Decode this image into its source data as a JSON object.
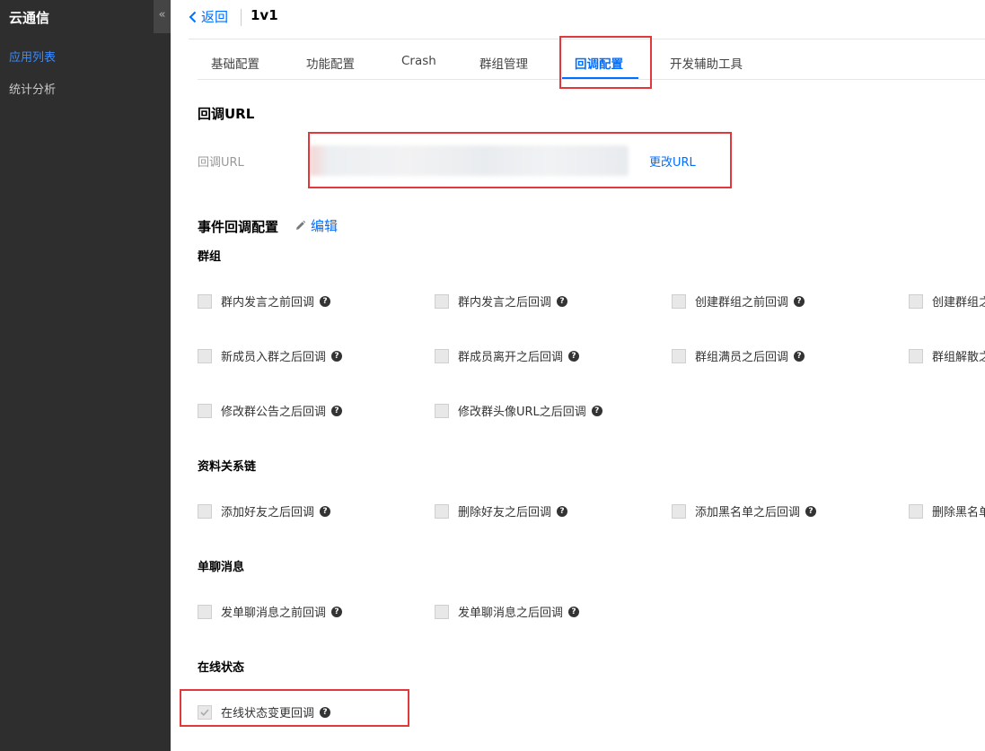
{
  "sidebar": {
    "brand": "云通信",
    "collapse_icon": "«",
    "items": [
      {
        "label": "应用列表",
        "active": true
      },
      {
        "label": "统计分析",
        "active": false
      }
    ]
  },
  "header": {
    "back_label": "返回",
    "app_name": "1v1"
  },
  "tabs": [
    {
      "label": "基础配置",
      "active": false
    },
    {
      "label": "功能配置",
      "active": false
    },
    {
      "label": "Crash",
      "active": false
    },
    {
      "label": "群组管理",
      "active": false
    },
    {
      "label": "回调配置",
      "active": true
    },
    {
      "label": "开发辅助工具",
      "active": false
    }
  ],
  "callback_url": {
    "section_title": "回调URL",
    "field_label": "回调URL",
    "change_label": "更改URL"
  },
  "events": {
    "section_title": "事件回调配置",
    "edit_label": "编辑",
    "groups": [
      {
        "title": "群组",
        "items": [
          {
            "label": "群内发言之前回调",
            "checked": false
          },
          {
            "label": "群内发言之后回调",
            "checked": false
          },
          {
            "label": "创建群组之前回调",
            "checked": false
          },
          {
            "label": "创建群组之",
            "checked": false
          },
          {
            "label": "新成员入群之后回调",
            "checked": false
          },
          {
            "label": "群成员离开之后回调",
            "checked": false
          },
          {
            "label": "群组满员之后回调",
            "checked": false
          },
          {
            "label": "群组解散之",
            "checked": false
          },
          {
            "label": "修改群公告之后回调",
            "checked": false
          },
          {
            "label": "修改群头像URL之后回调",
            "checked": false
          }
        ]
      },
      {
        "title": "资料关系链",
        "items": [
          {
            "label": "添加好友之后回调",
            "checked": false
          },
          {
            "label": "删除好友之后回调",
            "checked": false
          },
          {
            "label": "添加黑名单之后回调",
            "checked": false
          },
          {
            "label": "删除黑名单",
            "checked": false
          }
        ]
      },
      {
        "title": "单聊消息",
        "items": [
          {
            "label": "发单聊消息之前回调",
            "checked": false
          },
          {
            "label": "发单聊消息之后回调",
            "checked": false
          }
        ]
      },
      {
        "title": "在线状态",
        "items": [
          {
            "label": "在线状态变更回调",
            "checked": true
          }
        ]
      }
    ]
  },
  "colors": {
    "accent": "#006eff",
    "sidebar_bg": "#2e2e2e",
    "highlight_box": "#e1393b"
  }
}
